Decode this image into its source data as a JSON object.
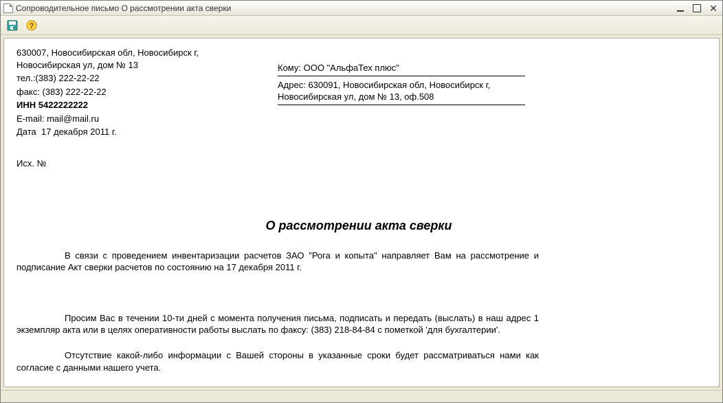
{
  "window": {
    "title": "Сопроводительное письмо О рассмотрении акта сверки"
  },
  "sender": {
    "address": "630007, Новосибирская обл, Новосибирск г, Новосибирская ул, дом № 13",
    "tel_label": "тел.:",
    "tel": "(383) 222-22-22",
    "fax_label": "факс:",
    "fax": "(383) 222-22-22",
    "inn_label": "ИНН",
    "inn": "5422222222",
    "email_label": "E-mail:",
    "email": "mail@mail.ru",
    "date_label": "Дата",
    "date": "17 декабря 2011 г."
  },
  "recipient": {
    "to_label": "Кому:",
    "to": "ООО \"АльфаТех плюс\"",
    "addr_label": "Адрес:",
    "addr": "630091, Новосибирская обл, Новосибирск г, Новосибирская ул, дом № 13, оф.508"
  },
  "outgoing_label": "Исх. №",
  "title": "О рассмотрении акта сверки",
  "paragraphs": {
    "p1": "В связи с проведением инвентаризации расчетов ЗАО \"Рога и копыта\" направляет Вам на рассмотрение и подписание Акт сверки расчетов  по состоянию на 17 декабря 2011 г.",
    "p2": "Просим Вас в течении 10-ти дней с момента получения письма, подписать и передать (выслать) в наш адрес 1 экземпляр акта или в целях оперативности работы выслать по факсу: (383) 218-84-84 с пометкой 'для бухгалтерии'.",
    "p3": "Отсутствие какой-либо информации с Вашей стороны в указанные сроки будет рассматриваться нами как согласие с данными нашего учета."
  }
}
